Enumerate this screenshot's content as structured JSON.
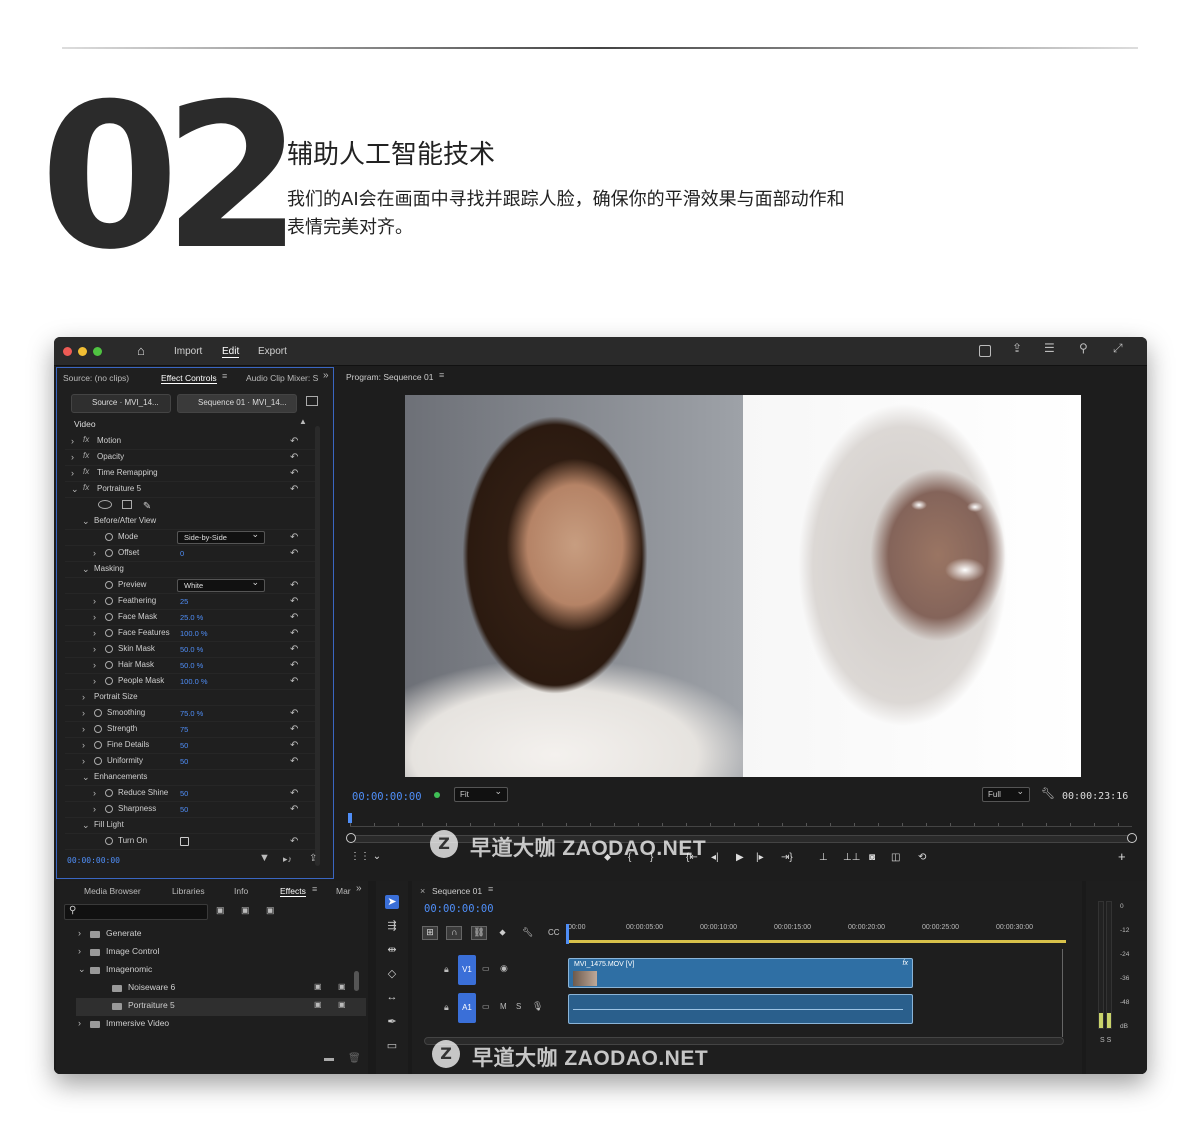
{
  "hero": {
    "number": "02",
    "heading": "辅助人工智能技术",
    "description": "我们的AI会在画面中寻找并跟踪人脸，确保你的平滑效果与面部动作和表情完美对齐。"
  },
  "app": {
    "menu": [
      "Import",
      "Edit",
      "Export"
    ],
    "active_menu": "Edit",
    "effect_controls": {
      "tabs": [
        "Source: (no clips)",
        "Effect Controls",
        "Audio Clip Mixer: S"
      ],
      "source_btn": "Source · MVI_14...",
      "sequence_btn": "Sequence 01 · MVI_14...",
      "section": "Video",
      "rows": [
        {
          "label": "Motion",
          "indent": 0,
          "fx": true,
          "chev": ">"
        },
        {
          "label": "Opacity",
          "indent": 0,
          "fx": true,
          "chev": ">"
        },
        {
          "label": "Time Remapping",
          "indent": 0,
          "fx": true,
          "chev": ">"
        },
        {
          "label": "Portraiture 5",
          "indent": 0,
          "fx": true,
          "chev": "v"
        },
        {
          "label": "Before/After View",
          "indent": 1,
          "chev": "v"
        },
        {
          "label": "Mode",
          "indent": 2,
          "stop": true,
          "dropdown": "Side-by-Side"
        },
        {
          "label": "Offset",
          "indent": 2,
          "stop": true,
          "chev": ">",
          "value": "0"
        },
        {
          "label": "Masking",
          "indent": 1,
          "chev": "v"
        },
        {
          "label": "Preview",
          "indent": 2,
          "stop": true,
          "dropdown": "White"
        },
        {
          "label": "Feathering",
          "indent": 2,
          "stop": true,
          "chev": ">",
          "value": "25"
        },
        {
          "label": "Face Mask",
          "indent": 2,
          "stop": true,
          "chev": ">",
          "value": "25.0 %"
        },
        {
          "label": "Face Features",
          "indent": 2,
          "stop": true,
          "chev": ">",
          "value": "100.0 %"
        },
        {
          "label": "Skin Mask",
          "indent": 2,
          "stop": true,
          "chev": ">",
          "value": "50.0 %"
        },
        {
          "label": "Hair Mask",
          "indent": 2,
          "stop": true,
          "chev": ">",
          "value": "50.0 %"
        },
        {
          "label": "People Mask",
          "indent": 2,
          "stop": true,
          "chev": ">",
          "value": "100.0 %"
        },
        {
          "label": "Portrait Size",
          "indent": 1,
          "chev": ">"
        },
        {
          "label": "Smoothing",
          "indent": 1,
          "stop": true,
          "chev": ">",
          "value": "75.0 %"
        },
        {
          "label": "Strength",
          "indent": 1,
          "stop": true,
          "chev": ">",
          "value": "75"
        },
        {
          "label": "Fine Details",
          "indent": 1,
          "stop": true,
          "chev": ">",
          "value": "50"
        },
        {
          "label": "Uniformity",
          "indent": 1,
          "stop": true,
          "chev": ">",
          "value": "50"
        },
        {
          "label": "Enhancements",
          "indent": 1,
          "chev": "v"
        },
        {
          "label": "Reduce Shine",
          "indent": 2,
          "stop": true,
          "chev": ">",
          "value": "50"
        },
        {
          "label": "Sharpness",
          "indent": 2,
          "stop": true,
          "chev": ">",
          "value": "50"
        },
        {
          "label": "Fill Light",
          "indent": 1,
          "chev": "v"
        },
        {
          "label": "Turn On",
          "indent": 2,
          "stop": true,
          "checkbox": true
        }
      ],
      "timecode": "00:00:00:00"
    },
    "program": {
      "title": "Program: Sequence 01",
      "timecode_left": "00:00:00:00",
      "fit": "Fit",
      "full": "Full",
      "timecode_right": "00:00:23:16"
    },
    "effects_panel": {
      "tabs": [
        "Media Browser",
        "Libraries",
        "Info",
        "Effects",
        "Mar"
      ],
      "active_tab": "Effects",
      "items": [
        {
          "label": "Generate",
          "indent": 0
        },
        {
          "label": "Image Control",
          "indent": 0
        },
        {
          "label": "Imagenomic",
          "indent": 0
        },
        {
          "label": "Noiseware 6",
          "indent": 1
        },
        {
          "label": "Portraiture 5",
          "indent": 1
        },
        {
          "label": "Immersive Video",
          "indent": 0
        }
      ]
    },
    "timeline": {
      "title": "Sequence 01",
      "timecode": "00:00:00:00",
      "ruler": [
        ":00:00",
        "00:00:05:00",
        "00:00:10:00",
        "00:00:15:00",
        "00:00:20:00",
        "00:00:25:00",
        "00:00:30:00"
      ],
      "v1": "V1",
      "a1": "A1",
      "clip_name": "MVI_1475.MOV [V]",
      "meter_labels": [
        "0",
        "-12",
        "-24",
        "-36",
        "-48",
        "dB"
      ],
      "meter_foot": "S S"
    }
  },
  "watermark": {
    "icon": "Z",
    "text": "早道大咖  ZAODAO.NET"
  },
  "colors": {
    "accent_blue": "#4f8ef7",
    "clip_blue": "#2f6fa4"
  }
}
